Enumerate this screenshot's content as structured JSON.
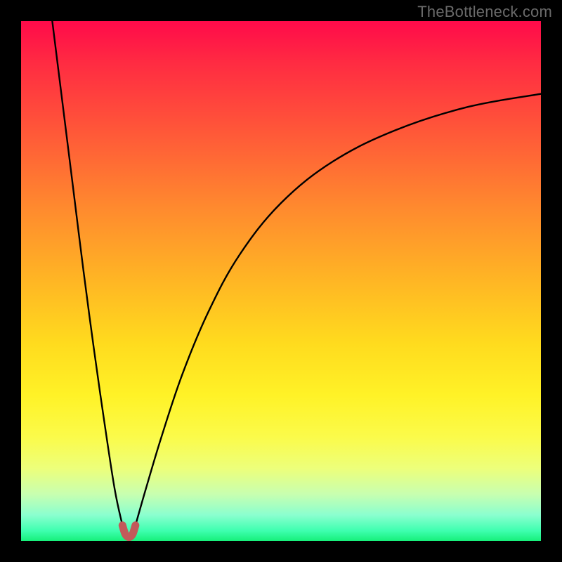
{
  "watermark": {
    "text": "TheBottleneck.com"
  },
  "colors": {
    "background": "#000000",
    "curve": "#000000",
    "marker": "#c25a5a",
    "gradient_top": "#ff0a4a",
    "gradient_bottom": "#16f07a"
  },
  "chart_data": {
    "type": "line",
    "title": "",
    "xlabel": "",
    "ylabel": "",
    "xlim": [
      0,
      100
    ],
    "ylim": [
      0,
      100
    ],
    "grid": false,
    "legend": false,
    "annotations": [
      "TheBottleneck.com"
    ],
    "background": "vertical red-to-green gradient (high=bad, low=good)",
    "series": [
      {
        "name": "left-branch",
        "comment": "Steep descending branch from top-left toward the minimum",
        "x": [
          6,
          8,
          10,
          12,
          14,
          16,
          18,
          19.5
        ],
        "values": [
          100,
          84,
          68,
          52,
          37,
          23,
          10,
          3
        ]
      },
      {
        "name": "right-branch",
        "comment": "Rising asymptotic branch from the minimum toward upper-right",
        "x": [
          22,
          24,
          27,
          31,
          36,
          42,
          50,
          60,
          72,
          86,
          100
        ],
        "values": [
          3,
          10,
          20,
          32,
          44,
          55,
          65,
          73,
          79,
          83.5,
          86
        ]
      },
      {
        "name": "minimum-marker",
        "comment": "Small U-shaped marker at the cusp / optimum point near the bottom",
        "x": [
          19.5,
          20,
          20.5,
          21,
          21.5,
          22
        ],
        "values": [
          3,
          1.4,
          0.8,
          0.8,
          1.4,
          3
        ]
      }
    ]
  }
}
